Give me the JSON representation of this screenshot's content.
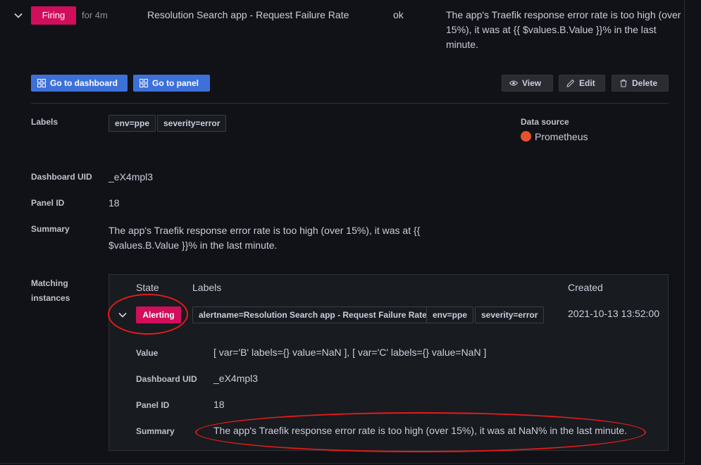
{
  "rule": {
    "state_badge": "Firing",
    "duration": "for 4m",
    "name": "Resolution Search app - Request Failure Rate",
    "health": "ok",
    "summary_preview": "The app's Traefik response error rate is too high (over 15%), it was at {{ $values.B.Value }}% in the last minute."
  },
  "actions": {
    "go_dashboard": "Go to dashboard",
    "go_panel": "Go to panel",
    "view": "View",
    "edit": "Edit",
    "delete": "Delete"
  },
  "details": {
    "labels_label": "Labels",
    "labels": [
      "env=ppe",
      "severity=error"
    ],
    "data_source_label": "Data source",
    "data_source": "Prometheus",
    "dashboard_uid_label": "Dashboard UID",
    "dashboard_uid": "_eX4mpl3",
    "panel_id_label": "Panel ID",
    "panel_id": "18",
    "summary_label": "Summary",
    "summary": "The app's Traefik response error rate is too high (over 15%), it was at {{ $values.B.Value }}% in the last minute.",
    "matching_label_1": "Matching",
    "matching_label_2": "instances"
  },
  "instances": {
    "headers": {
      "state": "State",
      "labels": "Labels",
      "created": "Created"
    },
    "row": {
      "state": "Alerting",
      "labels": [
        "alertname=Resolution Search app - Request Failure Rate",
        "env=ppe",
        "severity=error"
      ],
      "created": "2021-10-13 13:52:00",
      "value_label": "Value",
      "value": "[ var='B' labels={} value=NaN ], [ var='C' labels={} value=NaN ]",
      "dashboard_uid_label": "Dashboard UID",
      "dashboard_uid": "_eX4mpl3",
      "panel_id_label": "Panel ID",
      "panel_id": "18",
      "summary_label": "Summary",
      "summary": "The app's Traefik response error rate is too high (over 15%), it was at NaN% in the last minute."
    }
  },
  "colors": {
    "firing": "#d10e5c",
    "primary": "#3d71d9",
    "annotation": "#e31c1c",
    "prometheus": "#e6522c"
  },
  "icons": [
    "chevron-down-icon",
    "apps-icon",
    "eye-icon",
    "pen-icon",
    "trash-icon",
    "prometheus-icon"
  ]
}
